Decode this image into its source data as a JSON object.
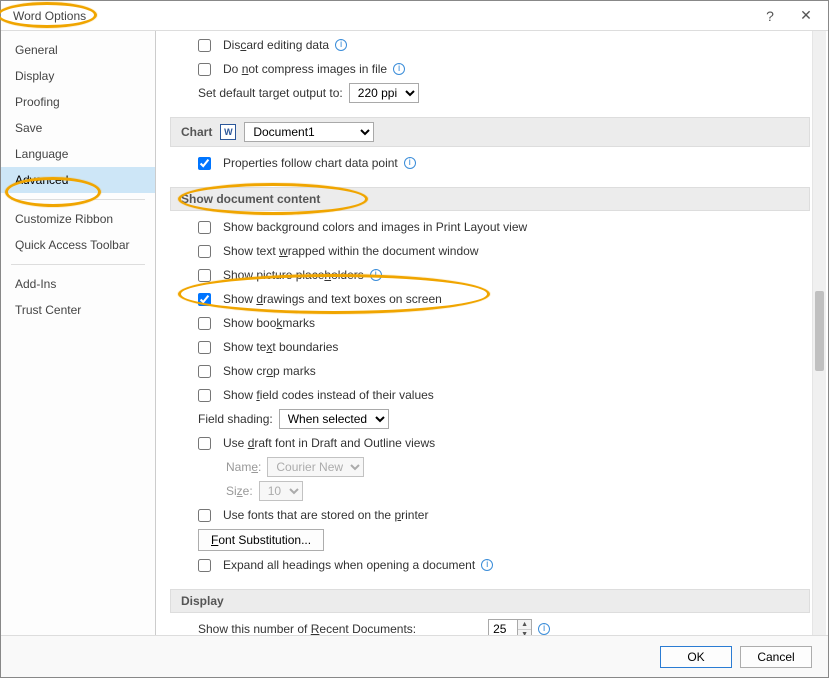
{
  "title": "Word Options",
  "sidebar": {
    "items": [
      {
        "label": "General"
      },
      {
        "label": "Display"
      },
      {
        "label": "Proofing"
      },
      {
        "label": "Save"
      },
      {
        "label": "Language"
      },
      {
        "label": "Advanced",
        "selected": true
      },
      {
        "label": "Customize Ribbon"
      },
      {
        "label": "Quick Access Toolbar"
      },
      {
        "label": "Add-Ins"
      },
      {
        "label": "Trust Center"
      }
    ]
  },
  "top_options": {
    "discard": {
      "label": "Discard editing data",
      "checked": false,
      "info": true
    },
    "compress": {
      "label": "Do not compress images in file",
      "checked": false,
      "info": true
    },
    "target_output_label": "Set default target output to:",
    "target_output_value": "220 ppi"
  },
  "chart_section": {
    "header": "Chart",
    "doc_value": "Document1",
    "props": {
      "label": "Properties follow chart data point",
      "checked": true,
      "info": true
    }
  },
  "show_doc_section": {
    "header": "Show document content",
    "items": [
      {
        "key": "bg",
        "label": "Show background colors and images in Print Layout view",
        "checked": false
      },
      {
        "key": "wrap",
        "label": "Show text wrapped within the document window",
        "checked": false
      },
      {
        "key": "placeholders",
        "label": "Show picture placeholders",
        "checked": false,
        "info": true
      },
      {
        "key": "drawings",
        "label": "Show drawings and text boxes on screen",
        "checked": true
      },
      {
        "key": "bookmarks",
        "label": "Show bookmarks",
        "checked": false
      },
      {
        "key": "boundaries",
        "label": "Show text boundaries",
        "checked": false
      },
      {
        "key": "crop",
        "label": "Show crop marks",
        "checked": false
      },
      {
        "key": "fieldcodes",
        "label": "Show field codes instead of their values",
        "checked": false
      }
    ],
    "field_shading_label": "Field shading:",
    "field_shading_value": "When selected",
    "draft_font": {
      "label": "Use draft font in Draft and Outline views",
      "checked": false
    },
    "name_label": "Name:",
    "name_value": "Courier New",
    "size_label": "Size:",
    "size_value": "10",
    "printer_fonts": {
      "label": "Use fonts that are stored on the printer",
      "checked": false
    },
    "font_sub_btn": "Font Substitution...",
    "expand_headings": {
      "label": "Expand all headings when opening a document",
      "checked": false,
      "info": true
    }
  },
  "display_section": {
    "header": "Display",
    "recent_label": "Show this number of Recent Documents:",
    "recent_value": "25"
  },
  "buttons": {
    "ok": "OK",
    "cancel": "Cancel"
  }
}
